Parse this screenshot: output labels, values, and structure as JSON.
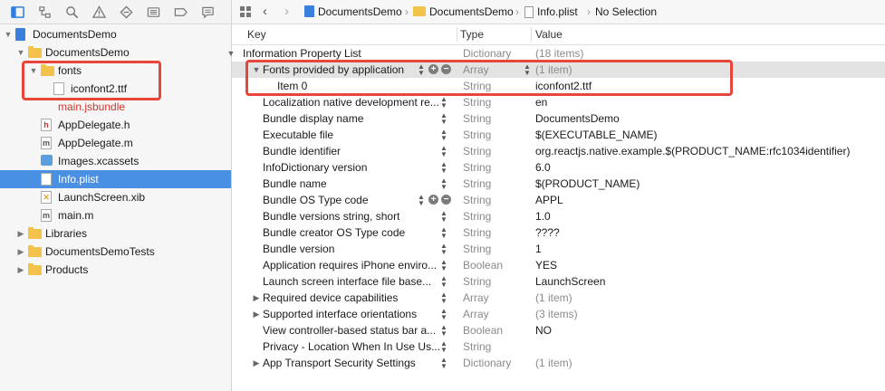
{
  "navigator": {
    "toolbar_icons": [
      "project-navigator-icon",
      "source-control-icon",
      "find-icon",
      "issue-icon",
      "test-icon",
      "debug-icon",
      "breakpoint-icon",
      "report-icon"
    ],
    "tree": [
      {
        "label": "DocumentsDemo",
        "type": "project",
        "indent": 0,
        "disclosure": "open"
      },
      {
        "label": "DocumentsDemo",
        "type": "folder",
        "indent": 1,
        "disclosure": "open"
      },
      {
        "label": "fonts",
        "type": "folder",
        "indent": 2,
        "disclosure": "open"
      },
      {
        "label": "iconfont2.ttf",
        "type": "file",
        "indent": 3,
        "disclosure": ""
      },
      {
        "label": "main.jsbundle",
        "type": "file-missing",
        "indent": 2,
        "disclosure": ""
      },
      {
        "label": "AppDelegate.h",
        "type": "header",
        "indent": 2,
        "disclosure": ""
      },
      {
        "label": "AppDelegate.m",
        "type": "source",
        "indent": 2,
        "disclosure": ""
      },
      {
        "label": "Images.xcassets",
        "type": "assets",
        "indent": 2,
        "disclosure": ""
      },
      {
        "label": "Info.plist",
        "type": "plist",
        "indent": 2,
        "disclosure": "",
        "selected": true
      },
      {
        "label": "LaunchScreen.xib",
        "type": "xib",
        "indent": 2,
        "disclosure": ""
      },
      {
        "label": "main.m",
        "type": "source",
        "indent": 2,
        "disclosure": ""
      },
      {
        "label": "Libraries",
        "type": "folder",
        "indent": 1,
        "disclosure": "closed"
      },
      {
        "label": "DocumentsDemoTests",
        "type": "folder",
        "indent": 1,
        "disclosure": "closed"
      },
      {
        "label": "Products",
        "type": "folder",
        "indent": 1,
        "disclosure": "closed"
      }
    ],
    "selected_color": "#4a90e2",
    "missing_color": "#d0342c"
  },
  "jumpbar": {
    "crumbs": [
      "DocumentsDemo",
      "DocumentsDemo",
      "Info.plist",
      "No Selection"
    ]
  },
  "plist": {
    "headers": {
      "key": "Key",
      "type": "Type",
      "value": "Value"
    },
    "rows": [
      {
        "key": "Information Property List",
        "type": "Dictionary",
        "value": "(18 items)",
        "level": 0,
        "disc": "open",
        "dim": true
      },
      {
        "key": "Fonts provided by application",
        "type": "Array",
        "value": "(1 item)",
        "level": 1,
        "disc": "open",
        "dim": true,
        "highlight": true,
        "controls": true
      },
      {
        "key": "Item 0",
        "type": "String",
        "value": "iconfont2.ttf",
        "level": 2,
        "disc": "",
        "dim": false
      },
      {
        "key": "Localization native development re...",
        "type": "String",
        "value": "en",
        "level": 1,
        "disc": "",
        "dim": false
      },
      {
        "key": "Bundle display name",
        "type": "String",
        "value": "DocumentsDemo",
        "level": 1,
        "disc": "",
        "dim": false
      },
      {
        "key": "Executable file",
        "type": "String",
        "value": "$(EXECUTABLE_NAME)",
        "level": 1,
        "disc": "",
        "dim": false
      },
      {
        "key": "Bundle identifier",
        "type": "String",
        "value": "org.reactjs.native.example.$(PRODUCT_NAME:rfc1034identifier)",
        "level": 1,
        "disc": "",
        "dim": false
      },
      {
        "key": "InfoDictionary version",
        "type": "String",
        "value": "6.0",
        "level": 1,
        "disc": "",
        "dim": false
      },
      {
        "key": "Bundle name",
        "type": "String",
        "value": "$(PRODUCT_NAME)",
        "level": 1,
        "disc": "",
        "dim": false
      },
      {
        "key": "Bundle OS Type code",
        "type": "String",
        "value": "APPL",
        "level": 1,
        "disc": "",
        "dim": false,
        "controls": true
      },
      {
        "key": "Bundle versions string, short",
        "type": "String",
        "value": "1.0",
        "level": 1,
        "disc": "",
        "dim": false
      },
      {
        "key": "Bundle creator OS Type code",
        "type": "String",
        "value": "????",
        "level": 1,
        "disc": "",
        "dim": false
      },
      {
        "key": "Bundle version",
        "type": "String",
        "value": "1",
        "level": 1,
        "disc": "",
        "dim": false
      },
      {
        "key": "Application requires iPhone enviro...",
        "type": "Boolean",
        "value": "YES",
        "level": 1,
        "disc": "",
        "dim": false
      },
      {
        "key": "Launch screen interface file base...",
        "type": "String",
        "value": "LaunchScreen",
        "level": 1,
        "disc": "",
        "dim": false
      },
      {
        "key": "Required device capabilities",
        "type": "Array",
        "value": "(1 item)",
        "level": 1,
        "disc": "closed",
        "dim": true
      },
      {
        "key": "Supported interface orientations",
        "type": "Array",
        "value": "(3 items)",
        "level": 1,
        "disc": "closed",
        "dim": true
      },
      {
        "key": "View controller-based status bar a...",
        "type": "Boolean",
        "value": "NO",
        "level": 1,
        "disc": "",
        "dim": false
      },
      {
        "key": "Privacy - Location When In Use Us...",
        "type": "String",
        "value": "",
        "level": 1,
        "disc": "",
        "dim": false
      },
      {
        "key": "App Transport Security Settings",
        "type": "Dictionary",
        "value": "(1 item)",
        "level": 1,
        "disc": "closed",
        "dim": true
      }
    ]
  },
  "annotations": {
    "color": "#e8463a"
  }
}
